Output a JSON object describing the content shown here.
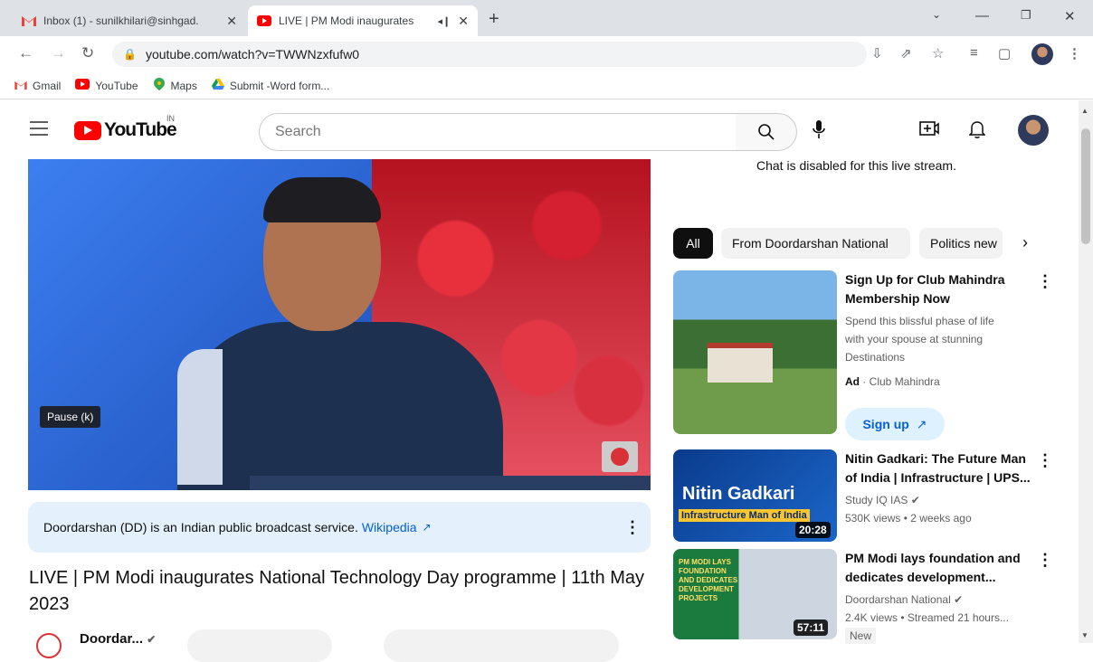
{
  "browser": {
    "tabs": [
      {
        "title": "Inbox (1) - sunilkhilari@sinhgad.",
        "icon": "gmail-icon"
      },
      {
        "title": "LIVE | PM Modi inaugurates",
        "icon": "youtube-icon",
        "audio": "◂❙"
      }
    ],
    "new_tab": "+",
    "url": "youtube.com/watch?v=TWWNzxfufw0",
    "bookmarks": [
      {
        "label": "Gmail",
        "icon": "gmail-icon"
      },
      {
        "label": "YouTube",
        "icon": "youtube-icon"
      },
      {
        "label": "Maps",
        "icon": "maps-icon"
      },
      {
        "label": "Submit -Word form...",
        "icon": "drive-icon"
      }
    ]
  },
  "youtube": {
    "logo_text": "YouTube",
    "country_code": "IN",
    "search_placeholder": "Search"
  },
  "player": {
    "tooltip": "Pause (k)"
  },
  "info_panel": {
    "text": "Doordarshan (DD) is an Indian public broadcast service.",
    "link": "Wikipedia"
  },
  "video": {
    "title": "LIVE | PM Modi inaugurates National Technology Day programme | 11th May 2023",
    "channel": "Doordar..."
  },
  "chat": {
    "disabled_text": "Chat is disabled for this live stream."
  },
  "chips": [
    "All",
    "From Doordarshan National",
    "Politics new"
  ],
  "recommendations": [
    {
      "title_line1": "Sign Up for Club Mahindra",
      "title_line2": "Membership Now",
      "desc_line1": "Spend this blissful phase of life",
      "desc_line2": "with your spouse at stunning",
      "desc_line3": "Destinations",
      "ad_label": "Ad",
      "advertiser": "· Club Mahindra",
      "button": "Sign up"
    },
    {
      "title_line1": "Nitin Gadkari: The Future Man",
      "title_line2": "of India | Infrastructure | UPS...",
      "channel": "Study IQ IAS",
      "meta": "530K views • 2 weeks ago",
      "duration": "20:28",
      "thumb_text1": "Nitin Gadkari",
      "thumb_text2": "Infrastructure Man of India"
    },
    {
      "title_line1": "PM Modi lays foundation and",
      "title_line2": "dedicates development...",
      "channel": "Doordarshan National",
      "meta": "2.4K views • Streamed 21 hours...",
      "badge": "New",
      "duration": "57:11",
      "thumb_text1": "PM MODI LAYS FOUNDATION AND DEDICATES DEVELOPMENT PROJECTS"
    }
  ]
}
